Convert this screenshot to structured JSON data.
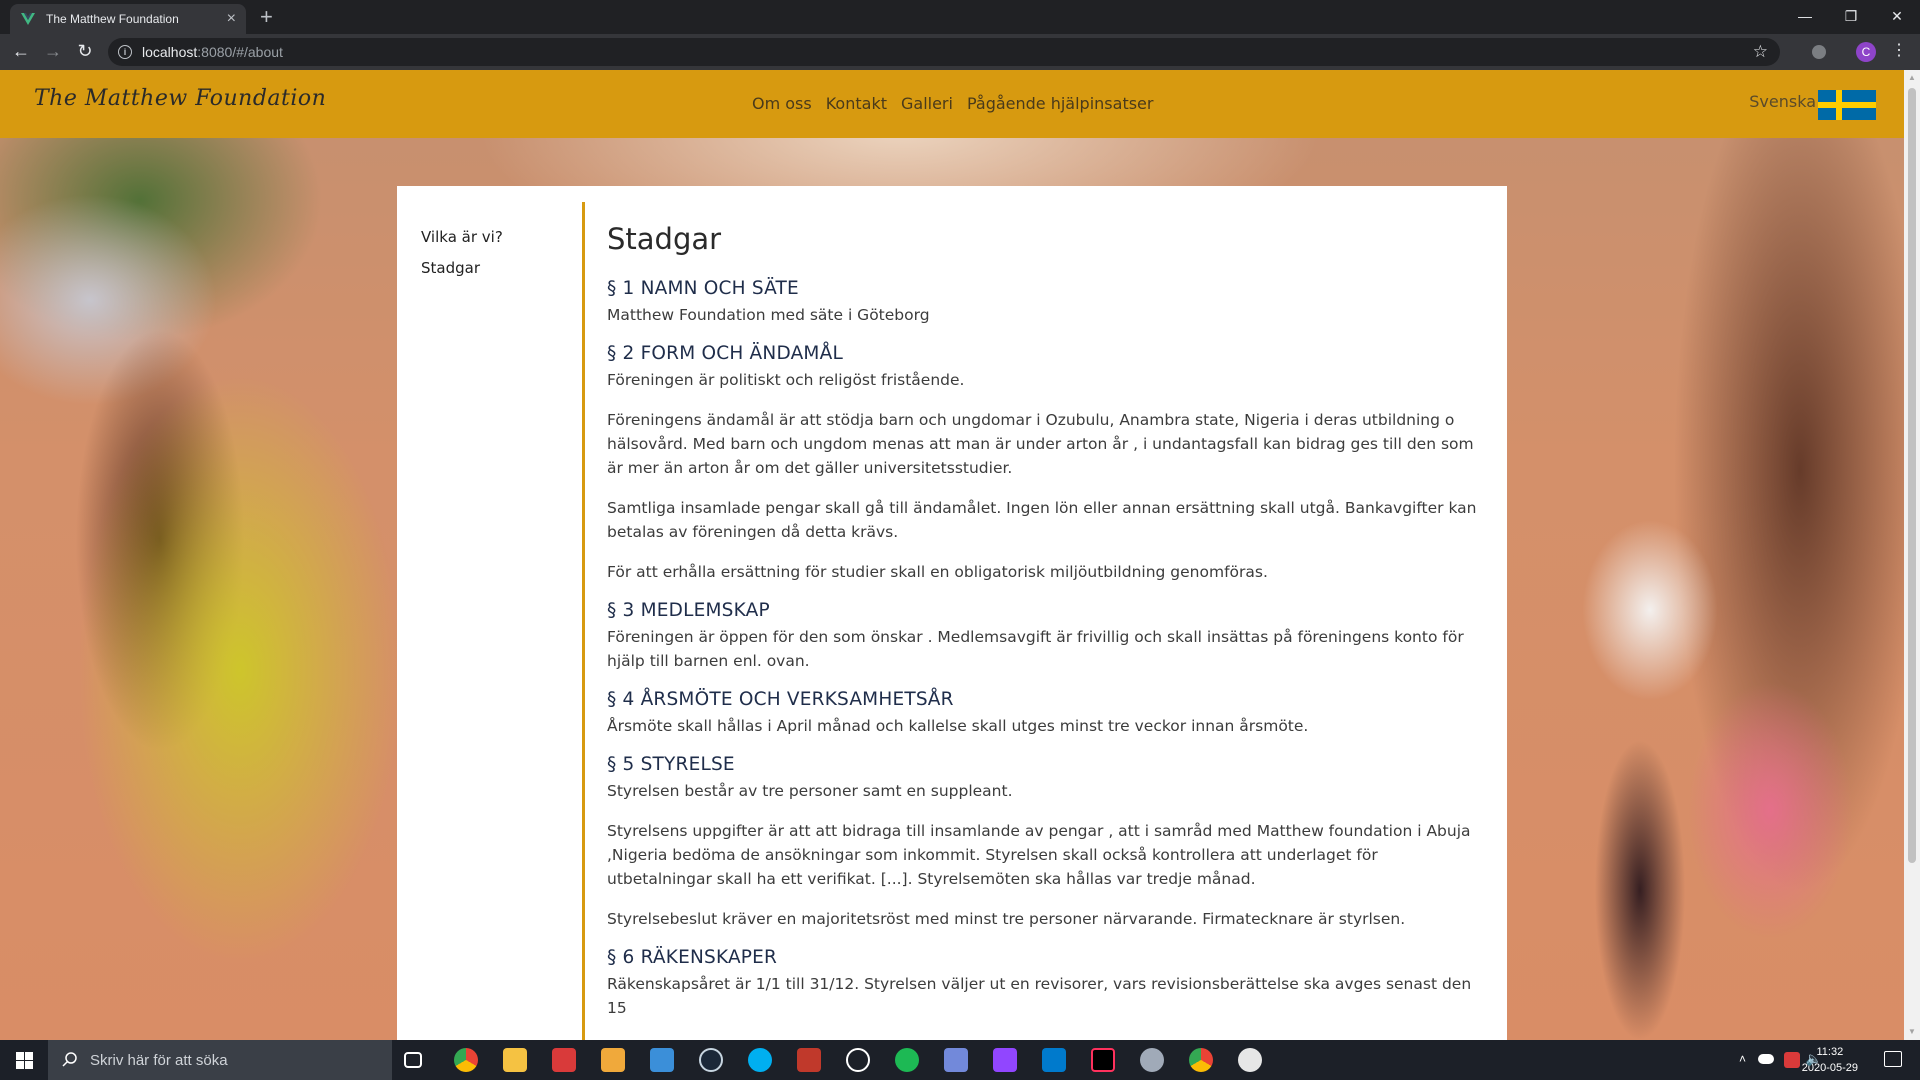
{
  "browser": {
    "tab_title": "The Matthew Foundation",
    "tab_close": "×",
    "new_tab": "+",
    "url_host": "localhost",
    "url_rest": ":8080/#/about",
    "profile_initial": "C",
    "window_controls": {
      "minimize": "—",
      "restore": "❐",
      "close": "✕"
    },
    "icons": [
      "back-arrow-icon",
      "forward-arrow-icon",
      "reload-icon",
      "info-icon",
      "bookmark-star-icon",
      "extension-icon",
      "menu-dots-icon"
    ]
  },
  "site": {
    "brand": "The Matthew Foundation",
    "nav": [
      "Om oss",
      "Kontakt",
      "Galleri",
      "Pågående hjälpinsatser"
    ],
    "language": "Svenska",
    "colors": {
      "header": "#d79a10",
      "accent_divider": "#d79a10",
      "flag_blue": "#006aa7",
      "flag_yellow": "#fecc00"
    }
  },
  "sidebar": {
    "items": [
      "Vilka är vi?",
      "Stadgar"
    ]
  },
  "content": {
    "title": "Stadgar",
    "sections": [
      {
        "heading": "§ 1 NAMN OCH SÄTE",
        "paragraphs": [
          "Matthew Foundation med säte i Göteborg"
        ]
      },
      {
        "heading": "§ 2 FORM OCH ÄNDAMÅL",
        "paragraphs": [
          "Föreningen är politiskt och religöst fristående.",
          "Föreningens ändamål är att stödja barn och ungdomar i Ozubulu, Anambra state, Nigeria i deras utbildning o hälsovård. Med barn och ungdom menas att man är under arton år , i undantagsfall kan bidrag ges till den som är mer än arton år om det gäller universitetsstudier.",
          "Samtliga insamlade pengar skall gå till ändamålet. Ingen lön eller annan ersättning skall utgå. Bankavgifter kan betalas av föreningen då detta krävs.",
          "För att erhålla ersättning för studier skall en obligatorisk miljöutbildning genomföras."
        ]
      },
      {
        "heading": "§ 3 MEDLEMSKAP",
        "paragraphs": [
          "Föreningen är öppen för den som önskar . Medlemsavgift är frivillig och skall insättas på föreningens konto för hjälp till barnen enl. ovan."
        ]
      },
      {
        "heading": "§ 4 ÅRSMÖTE OCH VERKSAMHETSÅR",
        "paragraphs": [
          "Årsmöte skall hållas i April månad och kallelse skall utges minst tre veckor innan årsmöte."
        ]
      },
      {
        "heading": "§ 5 STYRELSE",
        "paragraphs": [
          "Styrelsen består av tre personer samt en suppleant.",
          "Styrelsens uppgifter är att att bidraga till insamlande av pengar , att i samråd med Matthew foundation i Abuja ,Nigeria bedöma de ansökningar som inkommit. Styrelsen skall också kontrollera att underlaget för utbetalningar skall ha ett verifikat. [...]. Styrelsemöten ska hållas var tredje månad.",
          "Styrelsebeslut kräver en majoritetsröst med minst tre personer närvarande. Firmatecknare är styrlsen."
        ]
      },
      {
        "heading": "§ 6 RÄKENSKAPER",
        "paragraphs": [
          "Räkenskapsåret är 1/1 till 31/12. Styrelsen väljer ut en revisorer, vars revisionsberättelse ska avges senast den 15"
        ]
      }
    ]
  },
  "taskbar": {
    "search_placeholder": "Skriv här för att söka",
    "time": "11:32",
    "date": "2020-05-29",
    "apps": [
      "task-view-icon",
      "chrome-icon",
      "file-explorer-icon",
      "gift-icon",
      "store-icon",
      "mail-icon",
      "steam-icon",
      "skype-icon",
      "settings-app-icon",
      "speedometer-icon",
      "spotify-icon",
      "discord-icon",
      "twitch-icon",
      "vscode-icon",
      "intellij-icon",
      "game-app-icon",
      "chrome-dev-icon",
      "paint-icon"
    ]
  }
}
